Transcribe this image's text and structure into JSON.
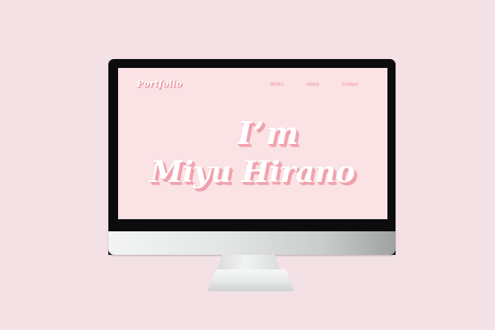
{
  "colors": {
    "background": "#f3e1e5",
    "screen": "#fae2e5",
    "accent": "#ef8fa0",
    "hero_text": "#ffffff",
    "hero_shadow": "#f2a3ae"
  },
  "site": {
    "logo": "Portfolio",
    "nav": {
      "works": "Works",
      "about": "About",
      "contact": "Contact"
    },
    "hero": {
      "line1": "I’m",
      "line2": "Miyu Hirano"
    }
  }
}
